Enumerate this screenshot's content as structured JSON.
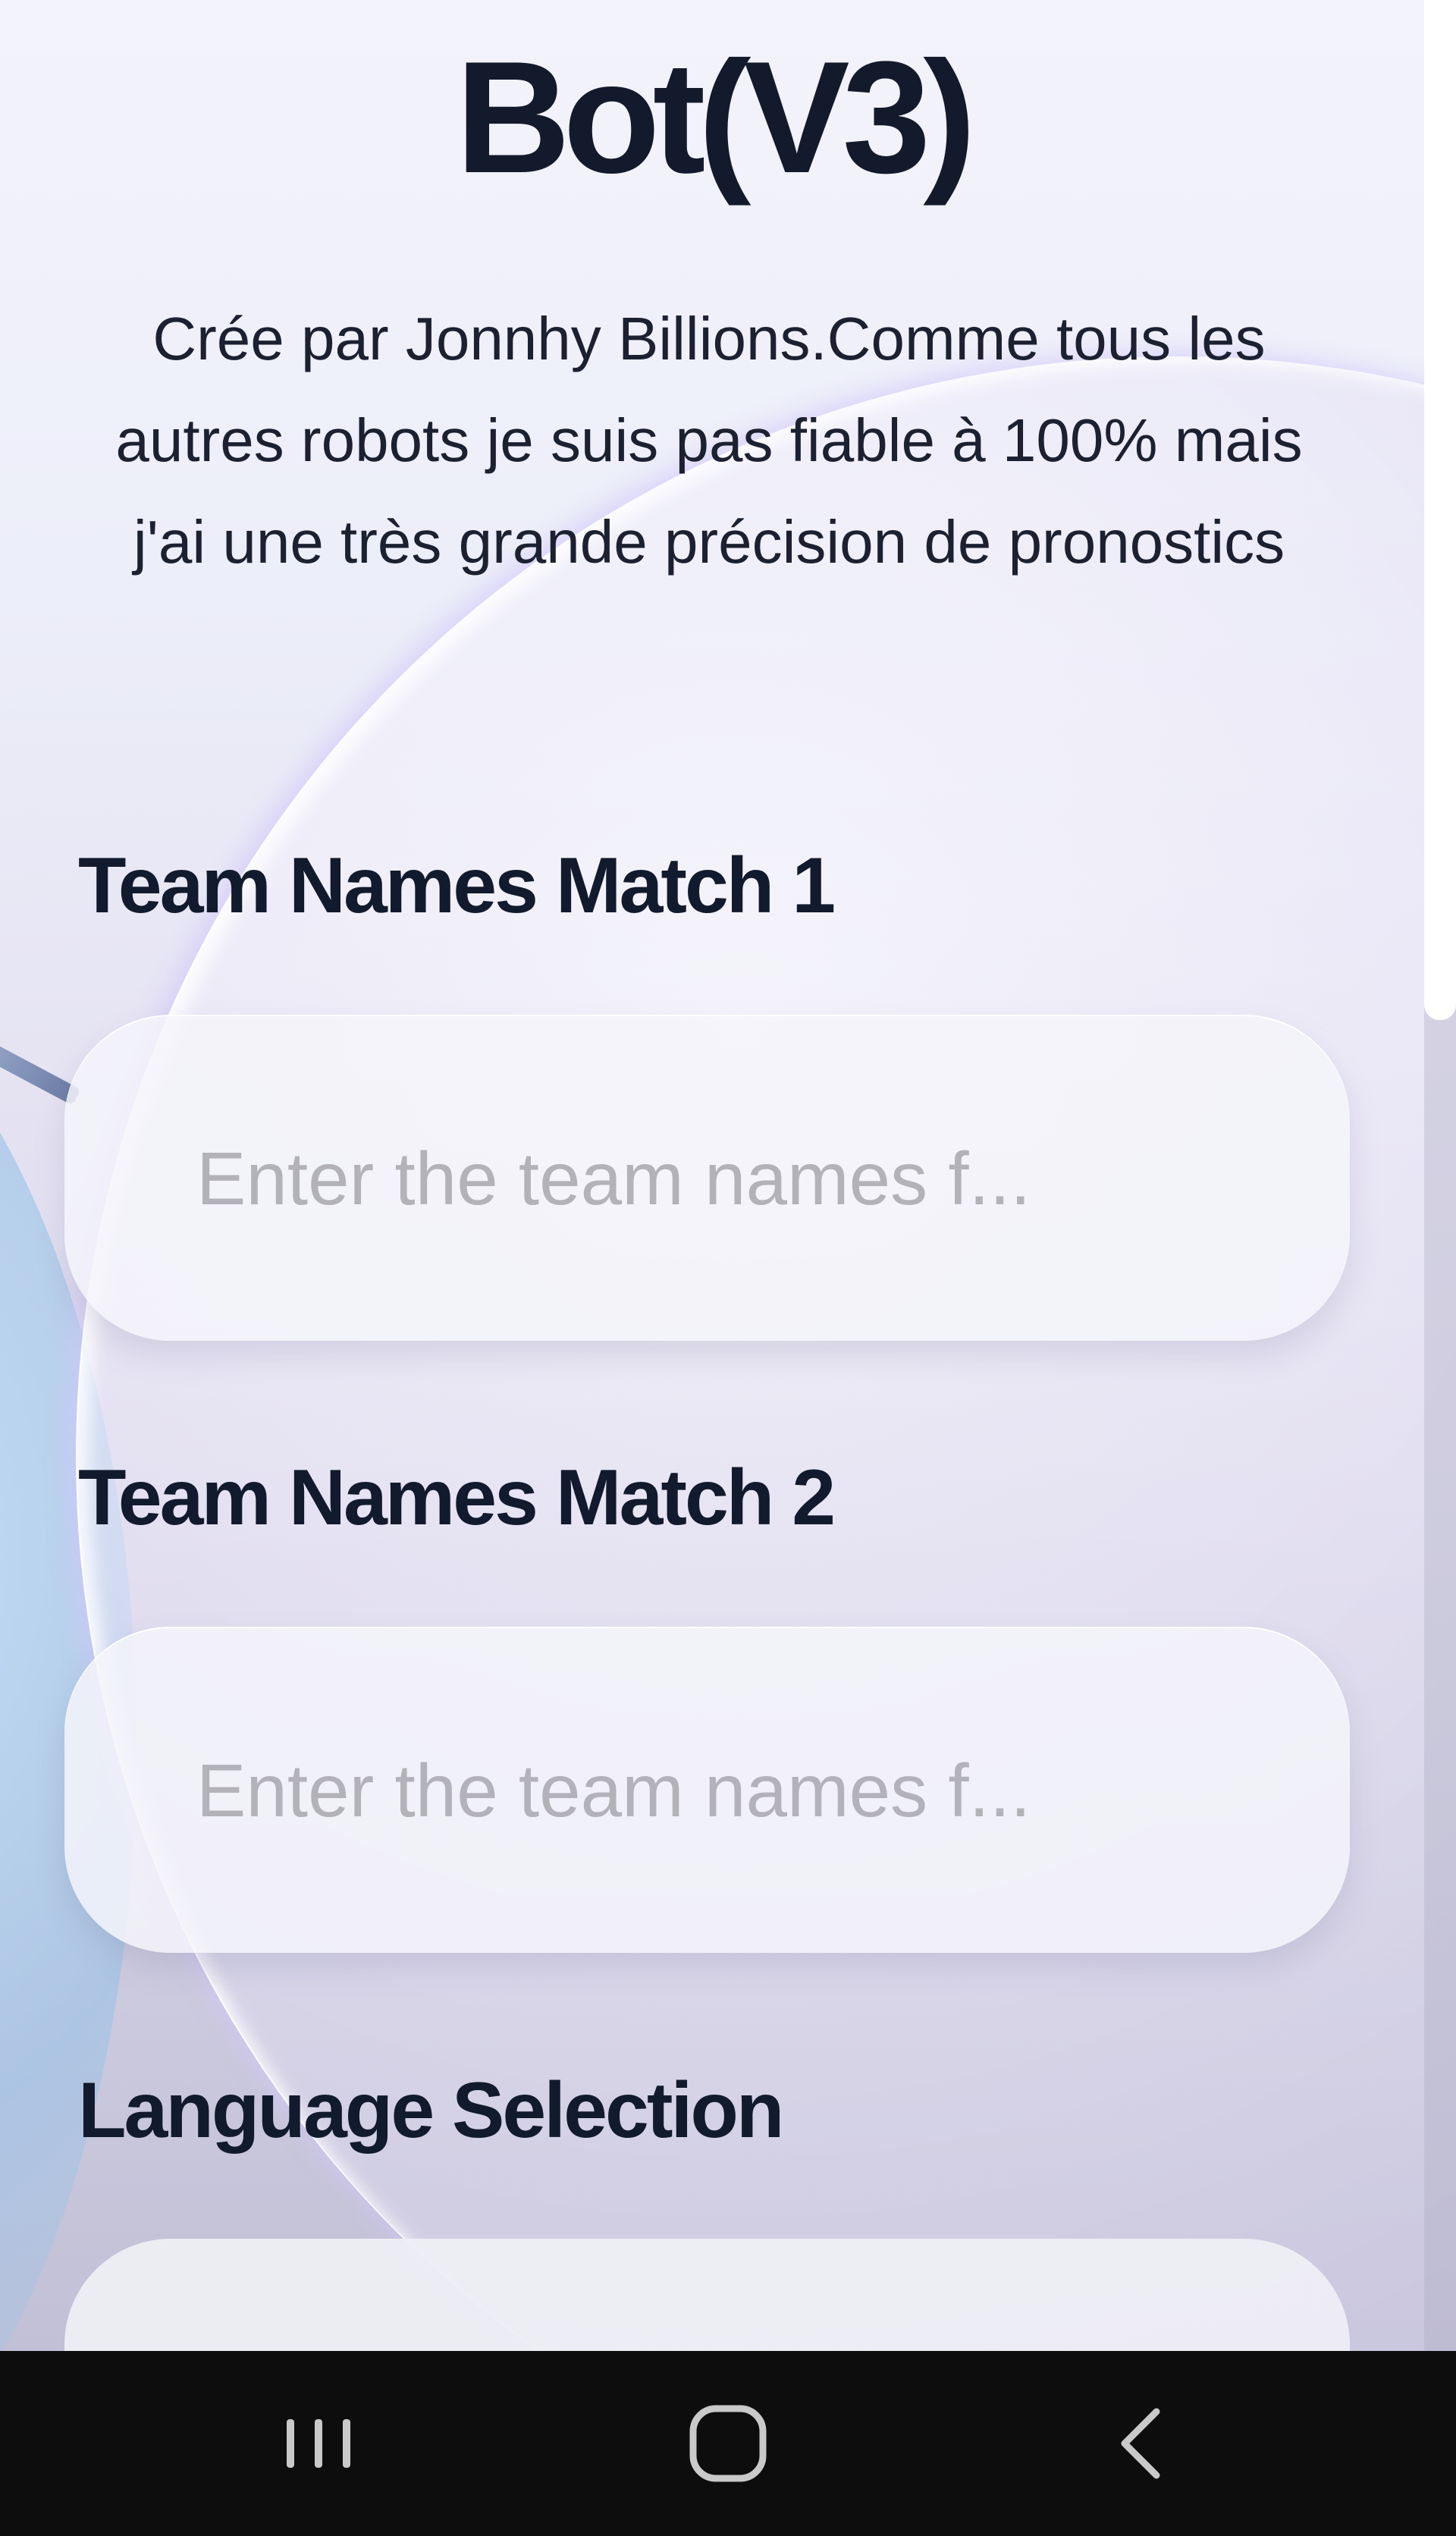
{
  "app": {
    "title": "Bot(V3)",
    "description": "Crée par Jonnhy Billions.Comme tous les autres robots je suis pas fiable à 100% mais j'ai une très grande précision de pronostics"
  },
  "form": {
    "match1": {
      "label": "Team Names Match 1",
      "placeholder": "Enter the team names f...",
      "value": ""
    },
    "match2": {
      "label": "Team Names Match 2",
      "placeholder": "Enter the team names f...",
      "value": ""
    },
    "language": {
      "label": "Language Selection",
      "selected": ""
    }
  },
  "navbar": {
    "icons": [
      "recent-apps-icon",
      "home-icon",
      "back-icon"
    ]
  },
  "colors": {
    "text_dark": "#131a2c",
    "placeholder": "#b3b2b8",
    "navbar_bg": "#0d0d0d"
  }
}
